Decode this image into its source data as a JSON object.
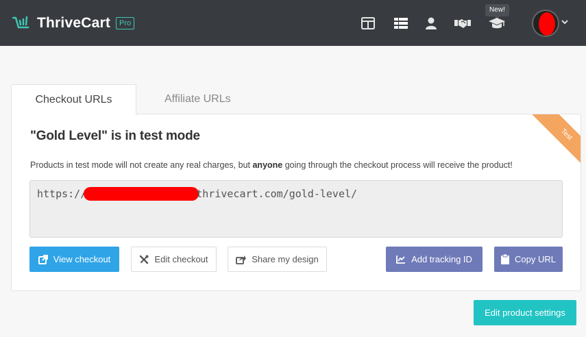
{
  "header": {
    "brand_name": "ThriveCart",
    "brand_badge": "Pro",
    "nav_icons": [
      "layout-icon",
      "list-icon",
      "user-icon",
      "handshake-icon",
      "graduation-cap-icon"
    ],
    "new_badge": "New!",
    "colors": {
      "bar": "#383b40",
      "accent": "#3fc7b4"
    }
  },
  "tabs": [
    {
      "label": "Checkout URLs",
      "active": true
    },
    {
      "label": "Affiliate URLs",
      "active": false
    }
  ],
  "panel": {
    "ribbon": "Test",
    "title": "\"Gold Level\" is in test mode",
    "description_before": "Products in test mode will not create any real charges, but ",
    "description_bold": "anyone",
    "description_after": " going through the checkout process will receive the product!",
    "url_prefix": "https://",
    "url_suffix": "thrivecart.com/gold-level/"
  },
  "buttons": {
    "view_checkout": "View checkout",
    "edit_checkout": "Edit checkout",
    "share_design": "Share my design",
    "add_tracking": "Add tracking ID",
    "copy_url": "Copy URL",
    "edit_product_settings": "Edit product settings"
  }
}
